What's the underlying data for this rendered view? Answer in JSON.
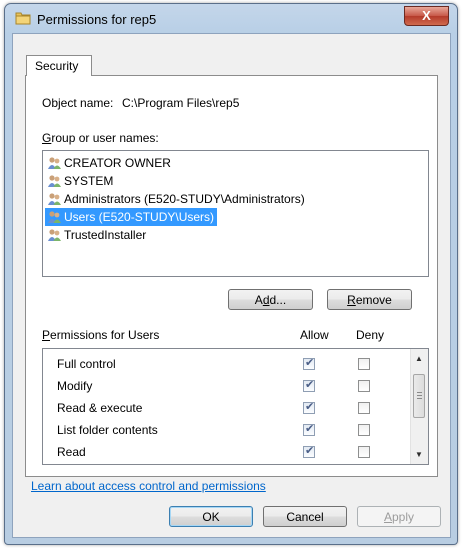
{
  "window": {
    "title": "Permissions for rep5",
    "close_label": "X"
  },
  "tab": {
    "label": "Security"
  },
  "object": {
    "label": "Object name:",
    "value": "C:\\Program Files\\rep5"
  },
  "group": {
    "label_pre": "",
    "label_acc": "G",
    "label_post": "roup or user names:",
    "users": [
      {
        "name": "CREATOR OWNER",
        "selected": false
      },
      {
        "name": "SYSTEM",
        "selected": false
      },
      {
        "name": "Administrators (E520-STUDY\\Administrators)",
        "selected": false
      },
      {
        "name": "Users (E520-STUDY\\Users)",
        "selected": true
      },
      {
        "name": "TrustedInstaller",
        "selected": false
      }
    ]
  },
  "buttons": {
    "add_pre": "A",
    "add_acc": "d",
    "add_post": "d...",
    "remove_pre": "",
    "remove_acc": "R",
    "remove_post": "emove",
    "ok": "OK",
    "cancel": "Cancel",
    "apply_pre": "",
    "apply_acc": "A",
    "apply_post": "pply"
  },
  "permissions": {
    "header_pre": "",
    "header_acc": "P",
    "header_post": "ermissions for Users",
    "allow_label": "Allow",
    "deny_label": "Deny",
    "rows": [
      {
        "name": "Full control",
        "allow": true,
        "deny": false
      },
      {
        "name": "Modify",
        "allow": true,
        "deny": false
      },
      {
        "name": "Read & execute",
        "allow": true,
        "deny": false
      },
      {
        "name": "List folder contents",
        "allow": true,
        "deny": false
      },
      {
        "name": "Read",
        "allow": true,
        "deny": false
      }
    ]
  },
  "link": {
    "text": "Learn about access control and permissions"
  },
  "icons": {
    "window": "folder-icon",
    "user": "users-icon"
  },
  "colors": {
    "selection": "#3399ff",
    "link": "#0066cc"
  }
}
